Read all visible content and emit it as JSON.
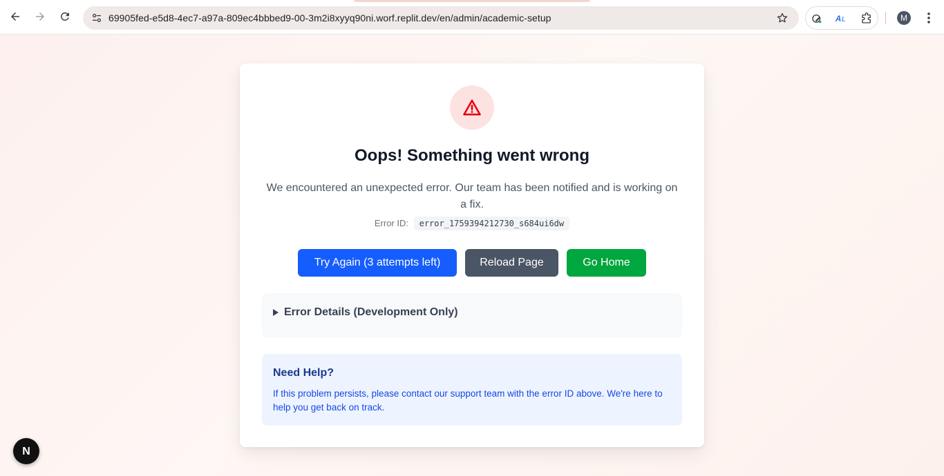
{
  "browser": {
    "url": "69905fed-e5d8-4ec7-a97a-809ec4bbbed9-00-3m2i8xyyq90ni.worf.replit.dev/en/admin/academic-setup",
    "profile_initial": "M"
  },
  "error_card": {
    "title": "Oops! Something went wrong",
    "description": "We encountered an unexpected error. Our team has been notified and is working on a fix.",
    "error_id_label": "Error ID:",
    "error_id": "error_1759394212730_s684ui6dw",
    "buttons": {
      "try_again": "Try Again (3 attempts left)",
      "reload": "Reload Page",
      "home": "Go Home"
    },
    "details_summary": "Error Details (Development Only)",
    "help": {
      "heading": "Need Help?",
      "text": "If this problem persists, please contact our support team with the error ID above. We're here to help you get back on track."
    }
  },
  "dev_badge": {
    "letter": "N"
  },
  "colors": {
    "primary_blue": "#155dfc",
    "reload_gray": "#4a5565",
    "home_green": "#00a63e",
    "warning_red": "#e7000b"
  }
}
